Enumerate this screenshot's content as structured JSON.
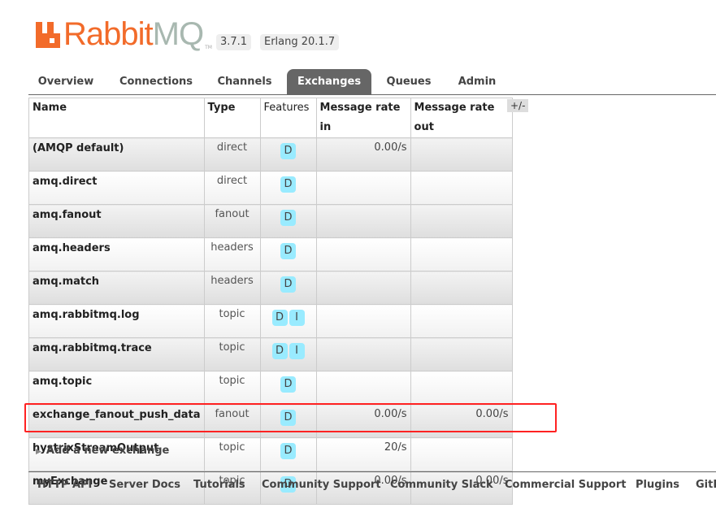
{
  "logo": {
    "text_rabbit": "Rabbit",
    "text_mq": "MQ",
    "tm": "TM"
  },
  "version": "3.7.1",
  "erlang": "Erlang 20.1.7",
  "tabs": [
    "Overview",
    "Connections",
    "Channels",
    "Exchanges",
    "Queues",
    "Admin"
  ],
  "active_tab": "Exchanges",
  "table": {
    "headers": [
      "Name",
      "Type",
      "Features",
      "Message rate in",
      "Message rate out"
    ],
    "toggle_columns": "+/-",
    "rows": [
      {
        "name": "(AMQP default)",
        "type": "direct",
        "features": [
          "D"
        ],
        "rate_in": "0.00/s",
        "rate_out": ""
      },
      {
        "name": "amq.direct",
        "type": "direct",
        "features": [
          "D"
        ],
        "rate_in": "",
        "rate_out": ""
      },
      {
        "name": "amq.fanout",
        "type": "fanout",
        "features": [
          "D"
        ],
        "rate_in": "",
        "rate_out": ""
      },
      {
        "name": "amq.headers",
        "type": "headers",
        "features": [
          "D"
        ],
        "rate_in": "",
        "rate_out": ""
      },
      {
        "name": "amq.match",
        "type": "headers",
        "features": [
          "D"
        ],
        "rate_in": "",
        "rate_out": ""
      },
      {
        "name": "amq.rabbitmq.log",
        "type": "topic",
        "features": [
          "D",
          "I"
        ],
        "rate_in": "",
        "rate_out": ""
      },
      {
        "name": "amq.rabbitmq.trace",
        "type": "topic",
        "features": [
          "D",
          "I"
        ],
        "rate_in": "",
        "rate_out": ""
      },
      {
        "name": "amq.topic",
        "type": "topic",
        "features": [
          "D"
        ],
        "rate_in": "",
        "rate_out": ""
      },
      {
        "name": "exchange_fanout_push_data",
        "type": "fanout",
        "features": [
          "D"
        ],
        "rate_in": "0.00/s",
        "rate_out": "0.00/s"
      },
      {
        "name": "hystrixStreamOutput",
        "type": "topic",
        "features": [
          "D"
        ],
        "rate_in": "20/s",
        "rate_out": ""
      },
      {
        "name": "myExchange",
        "type": "topic",
        "features": [
          "D"
        ],
        "rate_in": "0.00/s",
        "rate_out": "0.00/s"
      }
    ]
  },
  "highlight_color": "#ff2222",
  "add_exchange": "Add a new exchange",
  "footer": [
    "HTTP API",
    "Server Docs",
    "Tutorials",
    "Community Support",
    "Community Slack",
    "Commercial Support",
    "Plugins",
    "GitHub"
  ]
}
